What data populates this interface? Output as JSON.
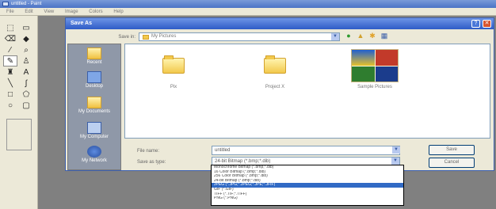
{
  "app": {
    "title": "untitled - Paint"
  },
  "menu": [
    "File",
    "Edit",
    "View",
    "Image",
    "Colors",
    "Help"
  ],
  "tools": [
    "free-select",
    "select",
    "eraser",
    "fill",
    "color-picker",
    "magnifier",
    "pencil",
    "brush",
    "airbrush",
    "text",
    "line",
    "curve",
    "rectangle",
    "polygon",
    "ellipse",
    "rounded-rectangle"
  ],
  "dialog": {
    "title": "Save As",
    "save_in_label": "Save in:",
    "save_in_value": "My Pictures",
    "places": [
      "Recent",
      "Desktop",
      "My Documents",
      "My Computer",
      "My Network"
    ],
    "files": [
      {
        "name": "Pix",
        "type": "folder"
      },
      {
        "name": "Project X",
        "type": "folder"
      },
      {
        "name": "Sample Pictures",
        "type": "folder-photos"
      }
    ],
    "file_name_label": "File name:",
    "file_name_value": "untitled",
    "save_as_type_label": "Save as type:",
    "save_as_type_value": "24-bit Bitmap (*.bmp;*.dib)",
    "save_button": "Save",
    "cancel_button": "Cancel"
  },
  "type_options": [
    "Monochrome Bitmap (*.bmp;*.dib)",
    "16 Color Bitmap (*.bmp;*.dib)",
    "256 Color Bitmap (*.bmp;*.dib)",
    "24-bit Bitmap (*.bmp;*.dib)",
    "JPEG (*.JPG;*.JPEG;*.JPE;*.JFIF)",
    "GIF (*.GIF)",
    "TIFF (*.TIF;*.TIFF)",
    "PNG (*.PNG)"
  ],
  "selected_type_index": 4,
  "colors": {
    "title_bar": "#2e5cc6",
    "selection": "#316ac5",
    "dialog_bg": "#ece9d8"
  }
}
